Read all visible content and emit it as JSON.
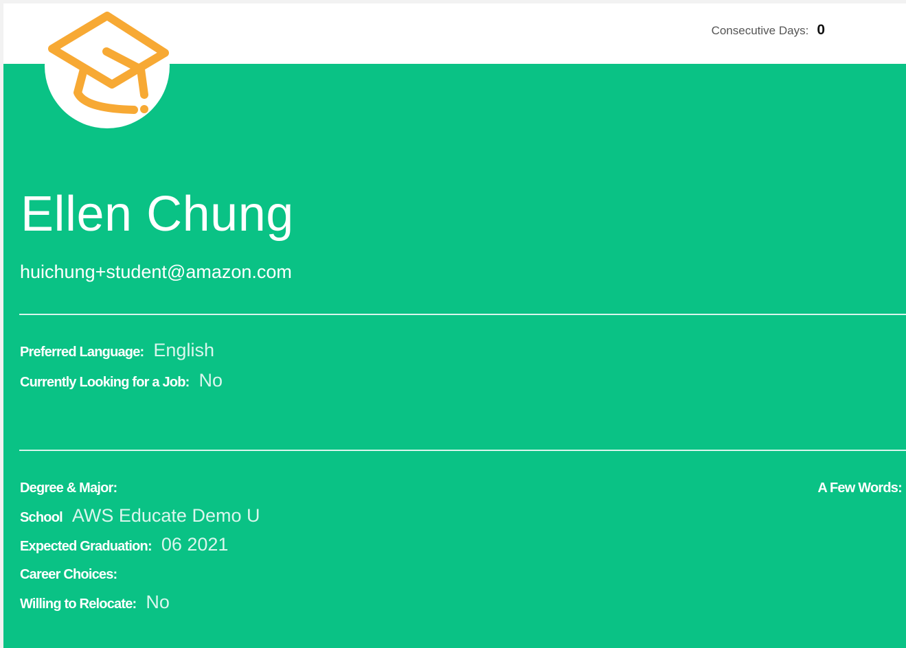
{
  "header": {
    "streak_label": "Consecutive Days:",
    "streak_value": "0"
  },
  "brand": {
    "logo_icon": "graduation-cap-icon",
    "accent_color": "#f7a934",
    "panel_color": "#0ac285"
  },
  "profile": {
    "name": "Ellen Chung",
    "email": "huichung+student@amazon.com"
  },
  "preferences": {
    "language_label": "Preferred Language:",
    "language_value": "English",
    "job_label": "Currently Looking for a Job:",
    "job_value": "No"
  },
  "education": {
    "degree_label": "Degree & Major:",
    "school_label": "School",
    "school_value": "AWS Educate Demo U",
    "graduation_label": "Expected Graduation:",
    "graduation_value": "06 2021",
    "career_label": "Career Choices:",
    "relocate_label": "Willing to Relocate:",
    "relocate_value": "No"
  },
  "about": {
    "few_words_label": "A Few Words:"
  }
}
